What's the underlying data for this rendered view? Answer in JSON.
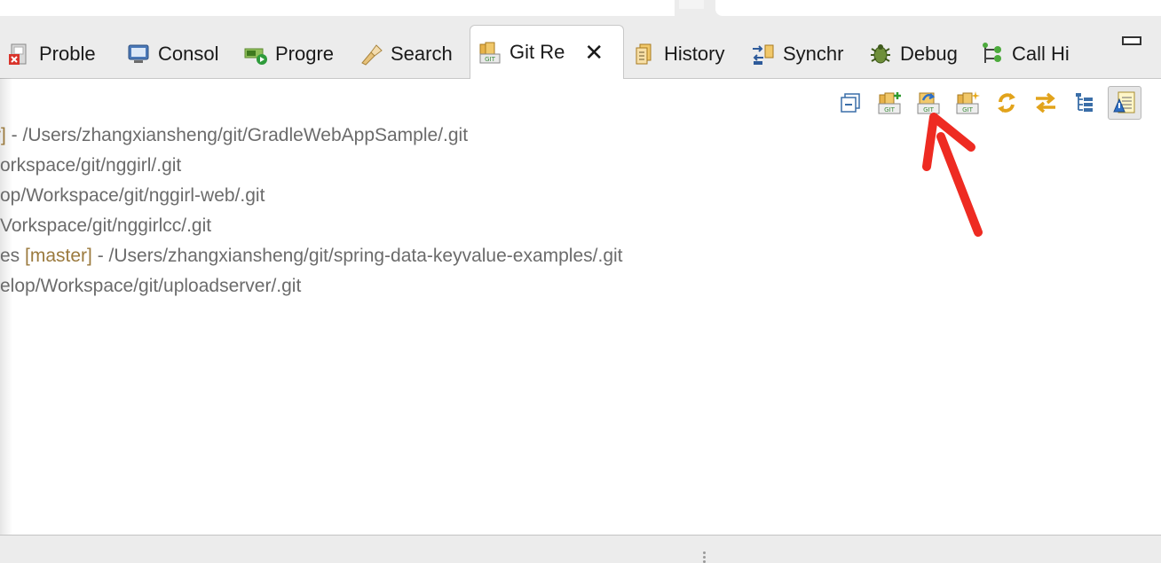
{
  "tabs": [
    {
      "label": "Proble",
      "icon": "problems-icon"
    },
    {
      "label": "Consol",
      "icon": "console-icon"
    },
    {
      "label": "Progre",
      "icon": "progress-icon"
    },
    {
      "label": "Search",
      "icon": "search-flashlight-icon"
    },
    {
      "label": "Git Re",
      "icon": "git-repositories-icon",
      "active": true
    },
    {
      "label": "History",
      "icon": "history-icon"
    },
    {
      "label": "Synchr",
      "icon": "synchronize-icon"
    },
    {
      "label": "Debug",
      "icon": "debug-bug-icon"
    },
    {
      "label": "Call Hi",
      "icon": "call-hierarchy-icon"
    }
  ],
  "toolbar_icons": [
    "collapse-all-icon",
    "add-existing-repository-icon",
    "clone-repository-icon",
    "create-repository-icon",
    "refresh-icon",
    "link-with-selection-icon",
    "hierarchical-view-icon",
    "show-annotations-icon"
  ],
  "repositories": [
    {
      "prefix": "",
      "branch": "r]",
      "path": " - /Users/zhangxiansheng/git/GradleWebAppSample/.git"
    },
    {
      "prefix": "orkspace/git/nggirl/.git",
      "branch": "",
      "path": ""
    },
    {
      "prefix": "op/Workspace/git/nggirl-web/.git",
      "branch": "",
      "path": ""
    },
    {
      "prefix": "Vorkspace/git/nggirlcc/.git",
      "branch": "",
      "path": ""
    },
    {
      "prefix": "es ",
      "branch": "[master]",
      "path": " - /Users/zhangxiansheng/git/spring-data-keyvalue-examples/.git"
    },
    {
      "prefix": "elop/Workspace/git/uploadserver/.git",
      "branch": "",
      "path": ""
    }
  ],
  "colors": {
    "branch": "#9b7a3e",
    "path_text": "#6b6b6b",
    "annotation_arrow": "#ee2b22"
  }
}
